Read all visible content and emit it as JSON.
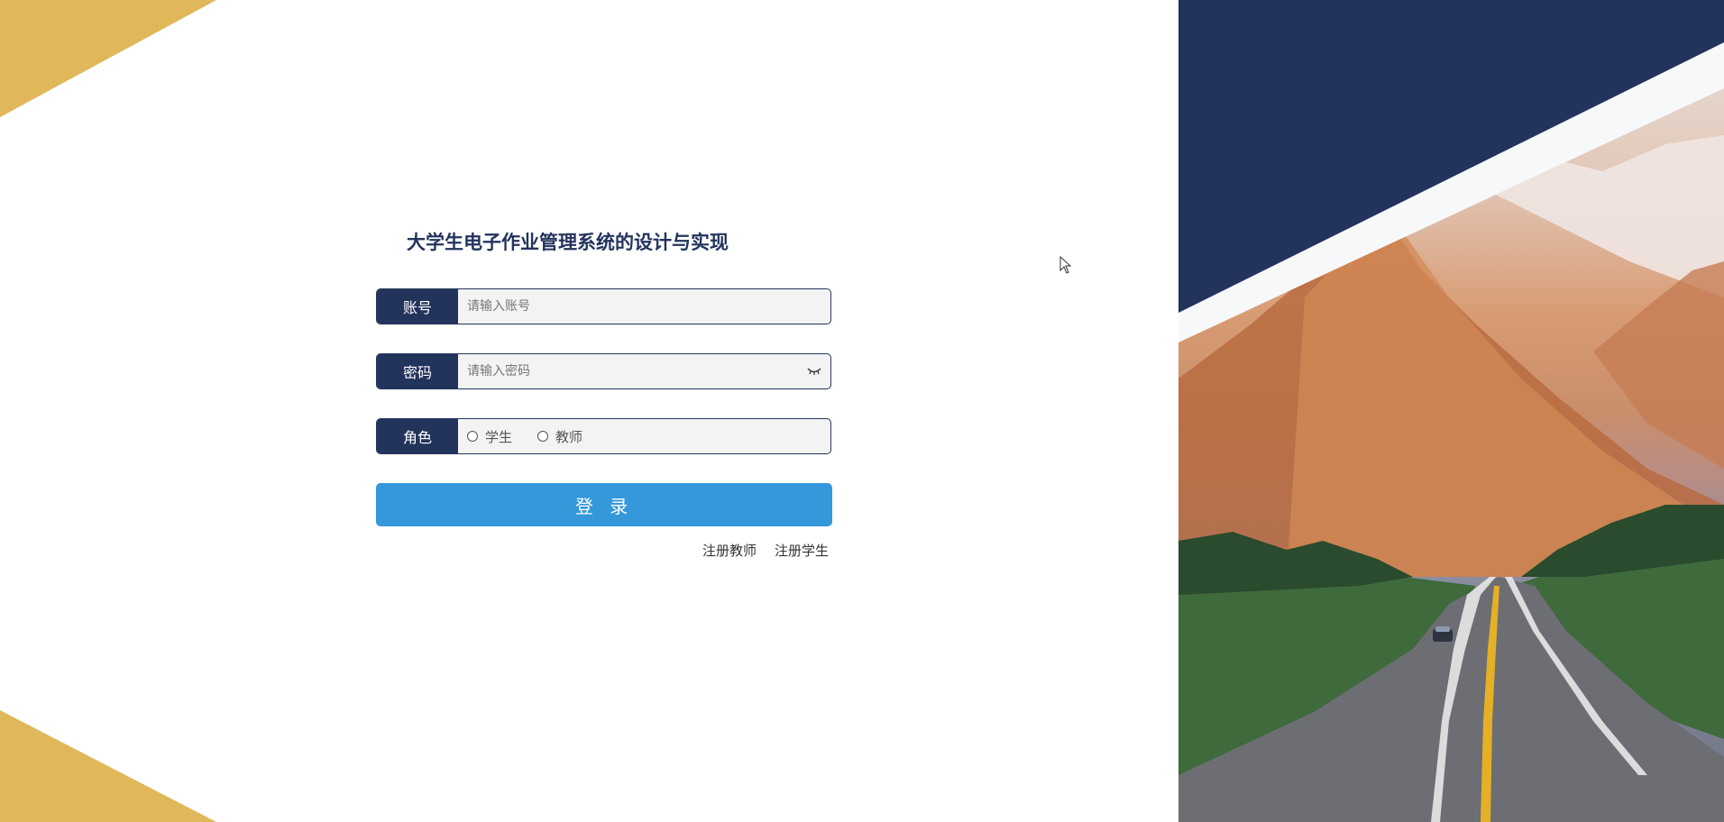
{
  "app": {
    "title": "大学生电子作业管理系统的设计与实现"
  },
  "login_form": {
    "account": {
      "label": "账号",
      "placeholder": "请输入账号"
    },
    "password": {
      "label": "密码",
      "placeholder": "请输入密码"
    },
    "role": {
      "label": "角色",
      "options": [
        "学生",
        "教师"
      ]
    },
    "login_button": "登 录",
    "links": {
      "register_teacher": "注册教师",
      "register_student": "注册学生"
    }
  },
  "colors": {
    "navy": "#23345c",
    "gold": "#e0b85a",
    "button_blue": "#3498da"
  },
  "icons": [
    "eye-closed-icon",
    "mouse-cursor-icon"
  ]
}
